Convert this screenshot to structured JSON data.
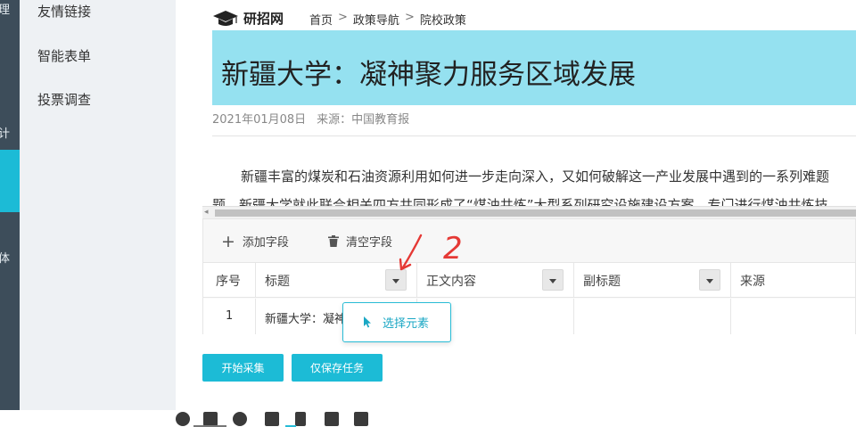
{
  "rail": {
    "labels": [
      "理",
      "计",
      "体"
    ]
  },
  "submenu": {
    "items": [
      "友情链接",
      "智能表单",
      "投票调查"
    ]
  },
  "preview": {
    "site_name": "研招网",
    "breadcrumb": [
      "首页",
      "政策导航",
      "院校政策"
    ],
    "breadcrumb_sep": ">",
    "article_title": "新疆大学：凝神聚力服务区域发展",
    "date": "2021年01月08日",
    "source": "来源：中国教育报",
    "paragraph1": "新疆丰富的煤炭和石油资源利用如何进一步走向深入，又如何破解这一产业发展中遇到的一系列难题",
    "paragraph2": "题，新疆大学就此联合相关四方共同形成了“煤油共炼”大型系列研究设施建设方案，专门进行煤油共炼技"
  },
  "toolbar": {
    "add_field": "添加字段",
    "clear_fields": "清空字段"
  },
  "table": {
    "headers": [
      "序号",
      "标题",
      "正文内容",
      "副标题",
      "来源"
    ],
    "rows": [
      {
        "index": "1",
        "title": "新疆大学：凝神"
      }
    ]
  },
  "popover": {
    "label": "选择元素"
  },
  "actions": {
    "start": "开始采集",
    "save_only": "仅保存任务"
  },
  "annotation": {
    "number": "2",
    "color": "#e53935"
  },
  "colors": {
    "accent": "#1cbbd6",
    "title_highlight": "#95e1f0",
    "rail": "#3d4d5a"
  }
}
